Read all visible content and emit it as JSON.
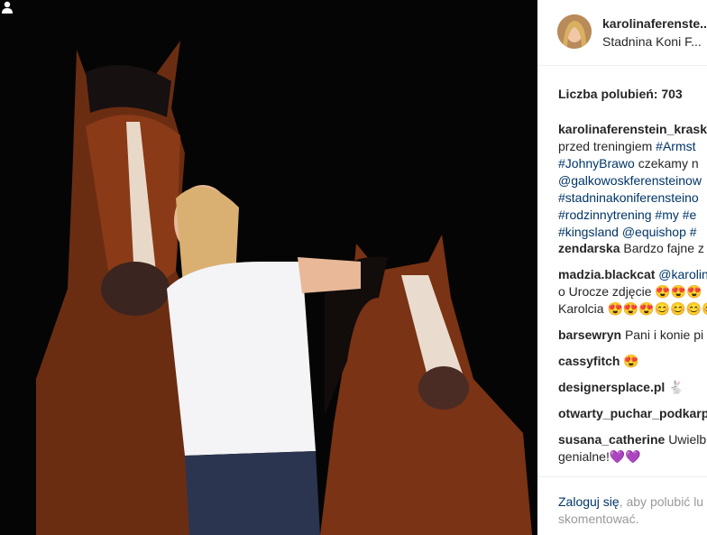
{
  "post": {
    "username": "karolinaferenste...",
    "location": "Stadnina Koni F..."
  },
  "likes": "Liczba polubień: 703",
  "caption": {
    "author": "karolinaferenstein_krask",
    "lines": [
      "przed treningiem #Armst",
      "#JohnyBrawo czekamy n",
      "@galkowoskferensteinow",
      "#stadninakoniferensteino",
      "#rodzinnytrening #my #e",
      "#kingsland @equishop #"
    ]
  },
  "comments": [
    {
      "user": "zendarska",
      "text": "Bardzo fajne z"
    },
    {
      "user": "madzia.blackcat",
      "text": "@karolin",
      "line2": "o Urocze zdjęcie 😍😍😍",
      "line3": "Karolcia 😍😍😍😊😊😊😊"
    },
    {
      "user": "barsewryn",
      "text": "Pani i konie pi"
    },
    {
      "user": "cassyfitch",
      "text": "😍"
    },
    {
      "user": "designersplace.pl",
      "text": "🐇"
    },
    {
      "user": "otwarty_puchar_podkarp",
      "text": ""
    },
    {
      "user": "susana_catherine",
      "text": "Uwielb",
      "line2": "genialne!💜💜"
    }
  ],
  "footer": {
    "login_link": "Zaloguj się",
    "login_rest": ", aby polubić lu",
    "login_line2": "skomentować."
  },
  "colors": {
    "link": "#003569",
    "text": "#262626",
    "muted": "#999999"
  },
  "icons": {
    "photo_tag": "person-icon",
    "avatar": "profile-photo"
  }
}
